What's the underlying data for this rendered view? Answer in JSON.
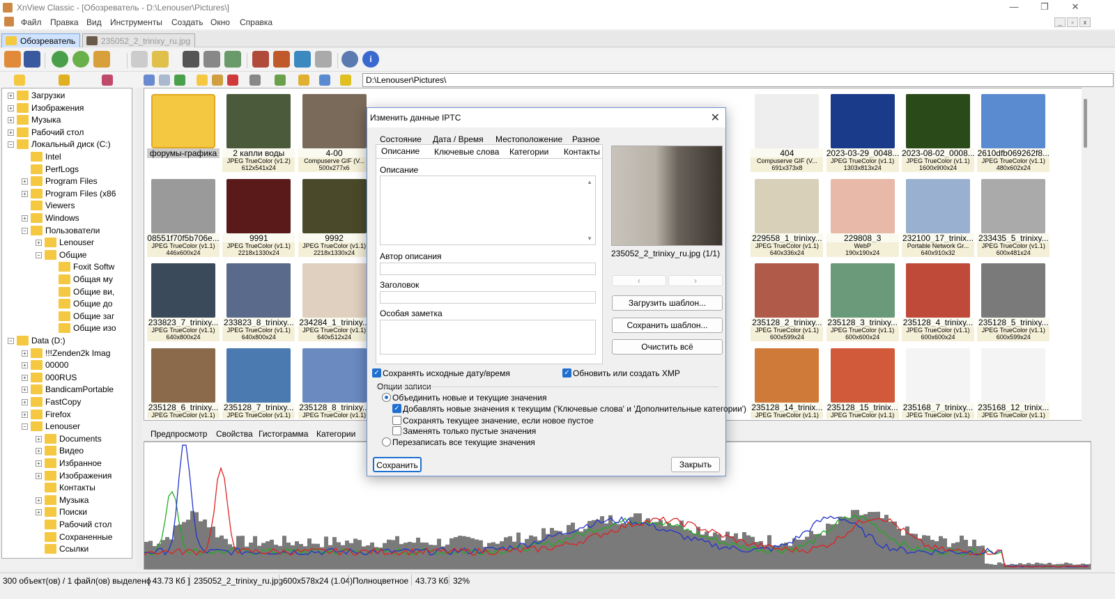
{
  "window": {
    "title": "XnView Classic - [Обозреватель - D:\\Lenouser\\Pictures\\]"
  },
  "menu": [
    "Файл",
    "Правка",
    "Вид",
    "Инструменты",
    "Создать",
    "Окно",
    "Справка"
  ],
  "tabs": [
    {
      "label": "Обозреватель"
    },
    {
      "label": "235052_2_trinixy_ru.jpg"
    }
  ],
  "address": {
    "path": "D:\\Lenouser\\Pictures\\"
  },
  "tree": [
    {
      "label": "Загрузки",
      "d": 1,
      "exp": "+"
    },
    {
      "label": "Изображения",
      "d": 1,
      "exp": "+"
    },
    {
      "label": "Музыка",
      "d": 1,
      "exp": "+"
    },
    {
      "label": "Рабочий стол",
      "d": 1,
      "exp": "+"
    },
    {
      "label": "Локальный диск (C:)",
      "d": 1,
      "exp": "−"
    },
    {
      "label": "Intel",
      "d": 2,
      "exp": ""
    },
    {
      "label": "PerfLogs",
      "d": 2,
      "exp": ""
    },
    {
      "label": "Program Files",
      "d": 2,
      "exp": "+"
    },
    {
      "label": "Program Files (x86",
      "d": 2,
      "exp": "+"
    },
    {
      "label": "Viewers",
      "d": 2,
      "exp": ""
    },
    {
      "label": "Windows",
      "d": 2,
      "exp": "+"
    },
    {
      "label": "Пользователи",
      "d": 2,
      "exp": "−"
    },
    {
      "label": "Lenouser",
      "d": 3,
      "exp": "+"
    },
    {
      "label": "Общие",
      "d": 3,
      "exp": "−"
    },
    {
      "label": "Foxit Softw",
      "d": 4,
      "exp": ""
    },
    {
      "label": "Общая му",
      "d": 4,
      "exp": ""
    },
    {
      "label": "Общие ви,",
      "d": 4,
      "exp": ""
    },
    {
      "label": "Общие до",
      "d": 4,
      "exp": ""
    },
    {
      "label": "Общие заг",
      "d": 4,
      "exp": ""
    },
    {
      "label": "Общие изо",
      "d": 4,
      "exp": ""
    },
    {
      "label": "Data (D:)",
      "d": 1,
      "exp": "−"
    },
    {
      "label": "!!!Zenden2k Imag",
      "d": 2,
      "exp": "+"
    },
    {
      "label": "00000",
      "d": 2,
      "exp": "+"
    },
    {
      "label": "000RUS",
      "d": 2,
      "exp": "+"
    },
    {
      "label": "BandicamPortable",
      "d": 2,
      "exp": "+"
    },
    {
      "label": "FastCopy",
      "d": 2,
      "exp": "+"
    },
    {
      "label": "Firefox",
      "d": 2,
      "exp": "+"
    },
    {
      "label": "Lenouser",
      "d": 2,
      "exp": "−"
    },
    {
      "label": "Documents",
      "d": 3,
      "exp": "+"
    },
    {
      "label": "Видео",
      "d": 3,
      "exp": "+"
    },
    {
      "label": "Избранное",
      "d": 3,
      "exp": "+"
    },
    {
      "label": "Изображения",
      "d": 3,
      "exp": "+"
    },
    {
      "label": "Контакты",
      "d": 3,
      "exp": ""
    },
    {
      "label": "Музыка",
      "d": 3,
      "exp": "+"
    },
    {
      "label": "Поиски",
      "d": 3,
      "exp": "+"
    },
    {
      "label": "Рабочий стол",
      "d": 3,
      "exp": ""
    },
    {
      "label": "Сохраненные",
      "d": 3,
      "exp": ""
    },
    {
      "label": "Ссылки",
      "d": 3,
      "exp": ""
    }
  ],
  "thumbs": [
    {
      "name": "форумы-графика",
      "info": "",
      "dims": "",
      "c": "#f5c842"
    },
    {
      "name": "2 капли воды",
      "info": "JPEG TrueColor (v1.2)",
      "dims": "612x541x24",
      "c": "#4a5a3a"
    },
    {
      "name": "4-00",
      "info": "Compuserve GIF (V...",
      "dims": "500x277x6",
      "c": "#7a6a5a"
    },
    {
      "name": "404",
      "info": "Compuserve GIF (V...",
      "dims": "691x373x8",
      "c": "#eeeeee",
      "col": 8
    },
    {
      "name": "2023-03-29_0048...",
      "info": "JPEG TrueColor (v1.1)",
      "dims": "1303x813x24",
      "c": "#1a3a8a",
      "col": 9
    },
    {
      "name": "2023-08-02_0008...",
      "info": "JPEG TrueColor (v1.1)",
      "dims": "1600x900x24",
      "c": "#2a4a1a",
      "col": 10
    },
    {
      "name": "2610dfb069262f8...",
      "info": "JPEG TrueColor (v1.1)",
      "dims": "480x602x24",
      "c": "#5a8ad0",
      "col": 11
    },
    {
      "name": "08551f70f5b706e...",
      "info": "JPEG TrueColor (v1.1)",
      "dims": "446x600x24",
      "c": "#9a9a9a"
    },
    {
      "name": "9991",
      "info": "JPEG TrueColor (v1.1)",
      "dims": "2218x1330x24",
      "c": "#5a1a1a"
    },
    {
      "name": "9992",
      "info": "JPEG TrueColor (v1.1)",
      "dims": "2218x1330x24",
      "c": "#4a4a2a"
    },
    {
      "name": "229558_1_trinixy...",
      "info": "JPEG TrueColor (v1.1)",
      "dims": "640x336x24",
      "c": "#d8d0b8",
      "col": 8
    },
    {
      "name": "229808_3",
      "info": "WebP",
      "dims": "190x190x24",
      "c": "#e8b8a8",
      "col": 9
    },
    {
      "name": "232100_17_trinix...",
      "info": "Portable Network Gr...",
      "dims": "640x910x32",
      "c": "#9ab0d0",
      "col": 10
    },
    {
      "name": "233435_5_trinixy...",
      "info": "JPEG TrueColor (v1.1)",
      "dims": "600x481x24",
      "c": "#aaaaaa",
      "col": 11
    },
    {
      "name": "233823_7_trinixy...",
      "info": "JPEG TrueColor (v1.1)",
      "dims": "640x800x24",
      "c": "#3a4a5a"
    },
    {
      "name": "233823_8_trinixy...",
      "info": "JPEG TrueColor (v1.1)",
      "dims": "640x800x24",
      "c": "#5a6a8a"
    },
    {
      "name": "234284_1_trinixy...",
      "info": "JPEG TrueColor (v1.1)",
      "dims": "640x512x24",
      "c": "#e0d0c0"
    },
    {
      "name": "235128_2_trinixy...",
      "info": "JPEG TrueColor (v1.1)",
      "dims": "600x599x24",
      "c": "#b05a4a",
      "col": 8
    },
    {
      "name": "235128_3_trinixy...",
      "info": "JPEG TrueColor (v1.1)",
      "dims": "600x600x24",
      "c": "#6a9a7a",
      "col": 9
    },
    {
      "name": "235128_4_trinixy...",
      "info": "JPEG TrueColor (v1.1)",
      "dims": "600x600x24",
      "c": "#c04a3a",
      "col": 10
    },
    {
      "name": "235128_5_trinixy...",
      "info": "JPEG TrueColor (v1.1)",
      "dims": "600x599x24",
      "c": "#7a7a7a",
      "col": 11
    },
    {
      "name": "235128_6_trinixy...",
      "info": "JPEG TrueColor (v1.1)",
      "dims": "",
      "c": "#8a6a4a"
    },
    {
      "name": "235128_7_trinixy...",
      "info": "JPEG TrueColor (v1.1)",
      "dims": "",
      "c": "#4a7ab0"
    },
    {
      "name": "235128_8_trinixy...",
      "info": "JPEG TrueColor (v1.1)",
      "dims": "",
      "c": "#6a8ac0"
    },
    {
      "name": "235128_14_trinix...",
      "info": "JPEG TrueColor (v1.1)",
      "dims": "",
      "c": "#d07a3a",
      "col": 8
    },
    {
      "name": "235128_15_trinix...",
      "info": "JPEG TrueColor (v1.1)",
      "dims": "",
      "c": "#d05a3a",
      "col": 9
    },
    {
      "name": "235168_7_trinixy...",
      "info": "JPEG TrueColor (v1.1)",
      "dims": "",
      "c": "#f4f4f4",
      "col": 10
    },
    {
      "name": "235168_12_trinix...",
      "info": "JPEG TrueColor (v1.1)",
      "dims": "",
      "c": "#f4f4f4",
      "col": 11
    }
  ],
  "panel_tabs": [
    "Предпросмотр",
    "Свойства",
    "Гистограмма",
    "Категории"
  ],
  "status": [
    "300 объект(ов) / 1 файл(ов) выделено",
    "[ 43.73 Кб ]",
    "235052_2_trinixy_ru.jpg",
    "600x578x24 (1.04)",
    "Полноцветное",
    "43.73 Кб",
    "32%"
  ],
  "dialog": {
    "title": "Изменить данные IPTC",
    "tabs_row1": [
      "Состояние",
      "Дата / Время",
      "Местоположение",
      "Разное"
    ],
    "tabs_row2": [
      "Описание",
      "Ключевые слова",
      "Категории",
      "Контакты"
    ],
    "lbl_desc": "Описание",
    "lbl_author": "Автор описания",
    "lbl_headline": "Заголовок",
    "lbl_note": "Особая заметка",
    "preview_caption": "235052_2_trinixy_ru.jpg (1/1)",
    "btn_load": "Загрузить шаблон...",
    "btn_save_tpl": "Сохранить шаблон...",
    "btn_clear": "Очистить всё",
    "chk_keep_date": "Сохранять исходные дату/время",
    "chk_xmp": "Обновить или создать XMP",
    "group": "Опции записи",
    "opt_merge": "Объединить новые и текущие значения",
    "opt_add": "Добавлять новые значения к текущим ('Ключевые слова' и 'Дополнительные категории')",
    "opt_keep": "Сохранять текущее значение, если новое пустое",
    "opt_empty": "Заменять только пустые значения",
    "opt_overwrite": "Перезаписать все текущие значения",
    "btn_save": "Сохранить",
    "btn_close": "Закрыть"
  }
}
